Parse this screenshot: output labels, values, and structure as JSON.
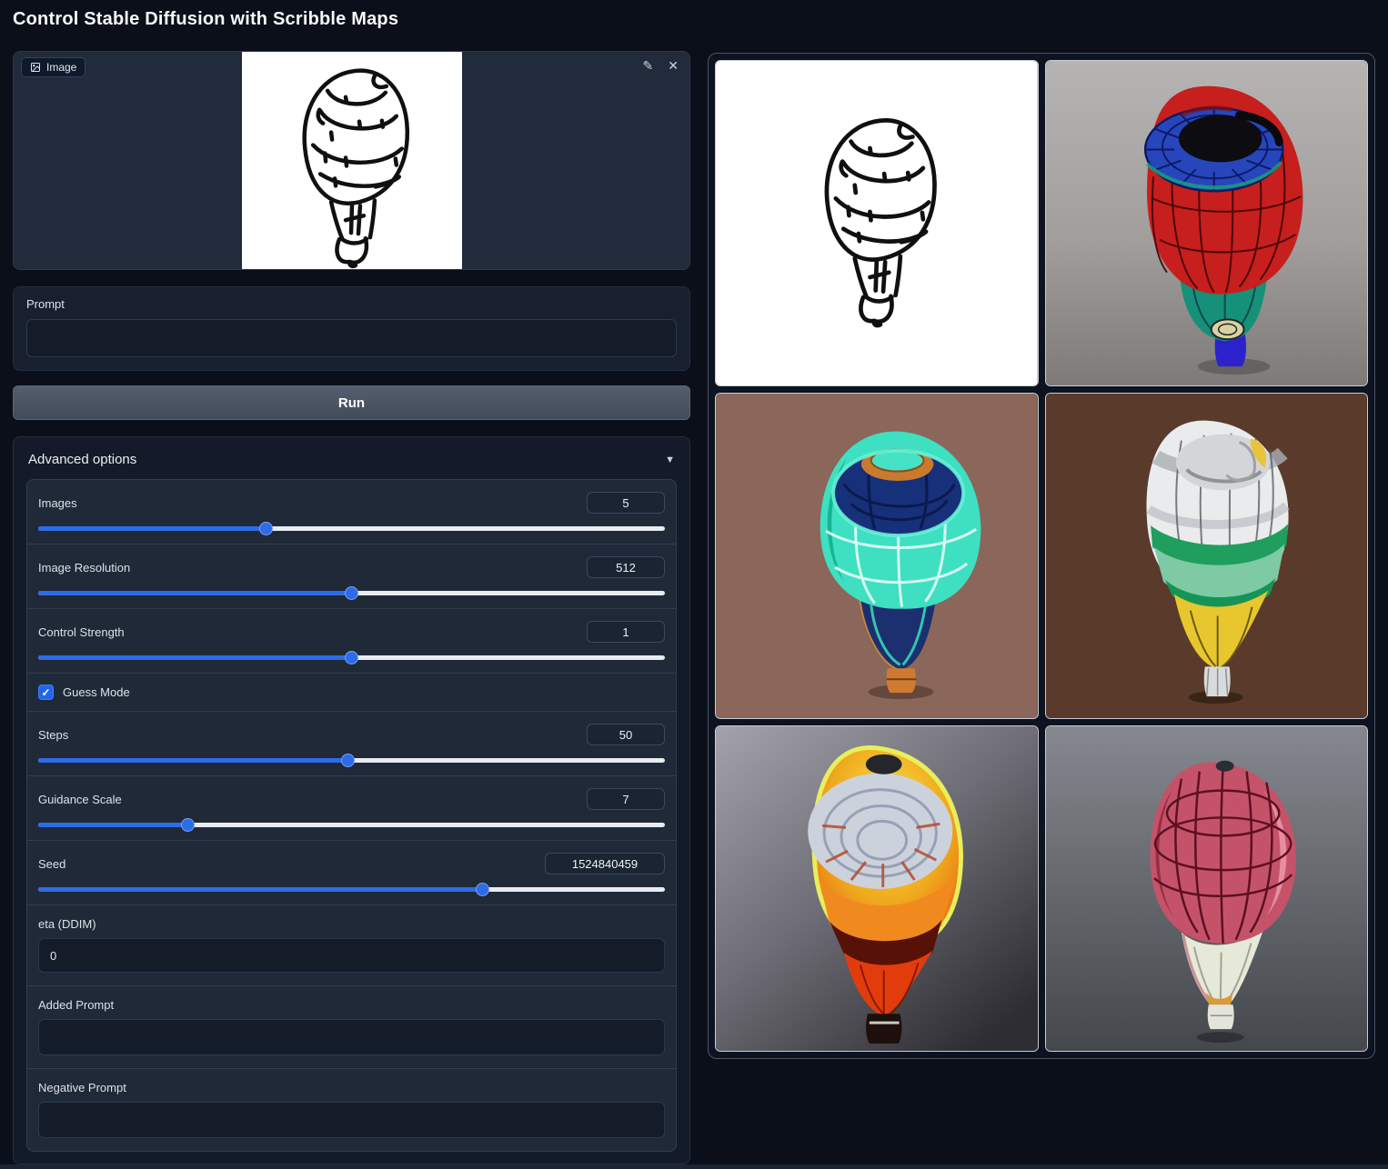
{
  "title": "Control Stable Diffusion with Scribble Maps",
  "colors": {
    "accent_blue": "#2e6be6",
    "checkbox_blue": "#2563eb",
    "page_bg": "#0b0f19",
    "panel_bg": "#1f2937",
    "slider_track": "#e8ebf0",
    "run_button_gray": "#4b5563"
  },
  "image_input": {
    "label": "Image",
    "edit_icon": "✎",
    "clear_icon": "✕"
  },
  "prompt": {
    "label": "Prompt",
    "value": ""
  },
  "run": {
    "label": "Run"
  },
  "advanced": {
    "header": "Advanced options",
    "caret": "▼",
    "guess_mode": {
      "label": "Guess Mode",
      "checked": true,
      "check_glyph": "✓"
    },
    "sliders": [
      {
        "label": "Images",
        "value": "5",
        "fill_pct": 36.5
      },
      {
        "label": "Image Resolution",
        "value": "512",
        "fill_pct": 50
      },
      {
        "label": "Control Strength",
        "value": "1",
        "fill_pct": 50
      },
      {
        "label": "Steps",
        "value": "50",
        "fill_pct": 49.5
      },
      {
        "label": "Guidance Scale",
        "value": "7",
        "fill_pct": 24
      },
      {
        "label": "Seed",
        "value": "1524840459",
        "fill_pct": 71
      }
    ],
    "eta": {
      "label": "eta (DDIM)",
      "value": "0"
    },
    "added_prompt": {
      "label": "Added Prompt",
      "value": ""
    },
    "negative_prompt": {
      "label": "Negative Prompt",
      "value": ""
    }
  },
  "gallery": {
    "items": [
      {
        "name": "scribble-balloon-sketch"
      },
      {
        "name": "balloon-red-blue-wireframe"
      },
      {
        "name": "balloon-teal-navy"
      },
      {
        "name": "balloon-white-green-yellow"
      },
      {
        "name": "balloon-orange-glow"
      },
      {
        "name": "balloon-pink-wireframe"
      }
    ]
  }
}
